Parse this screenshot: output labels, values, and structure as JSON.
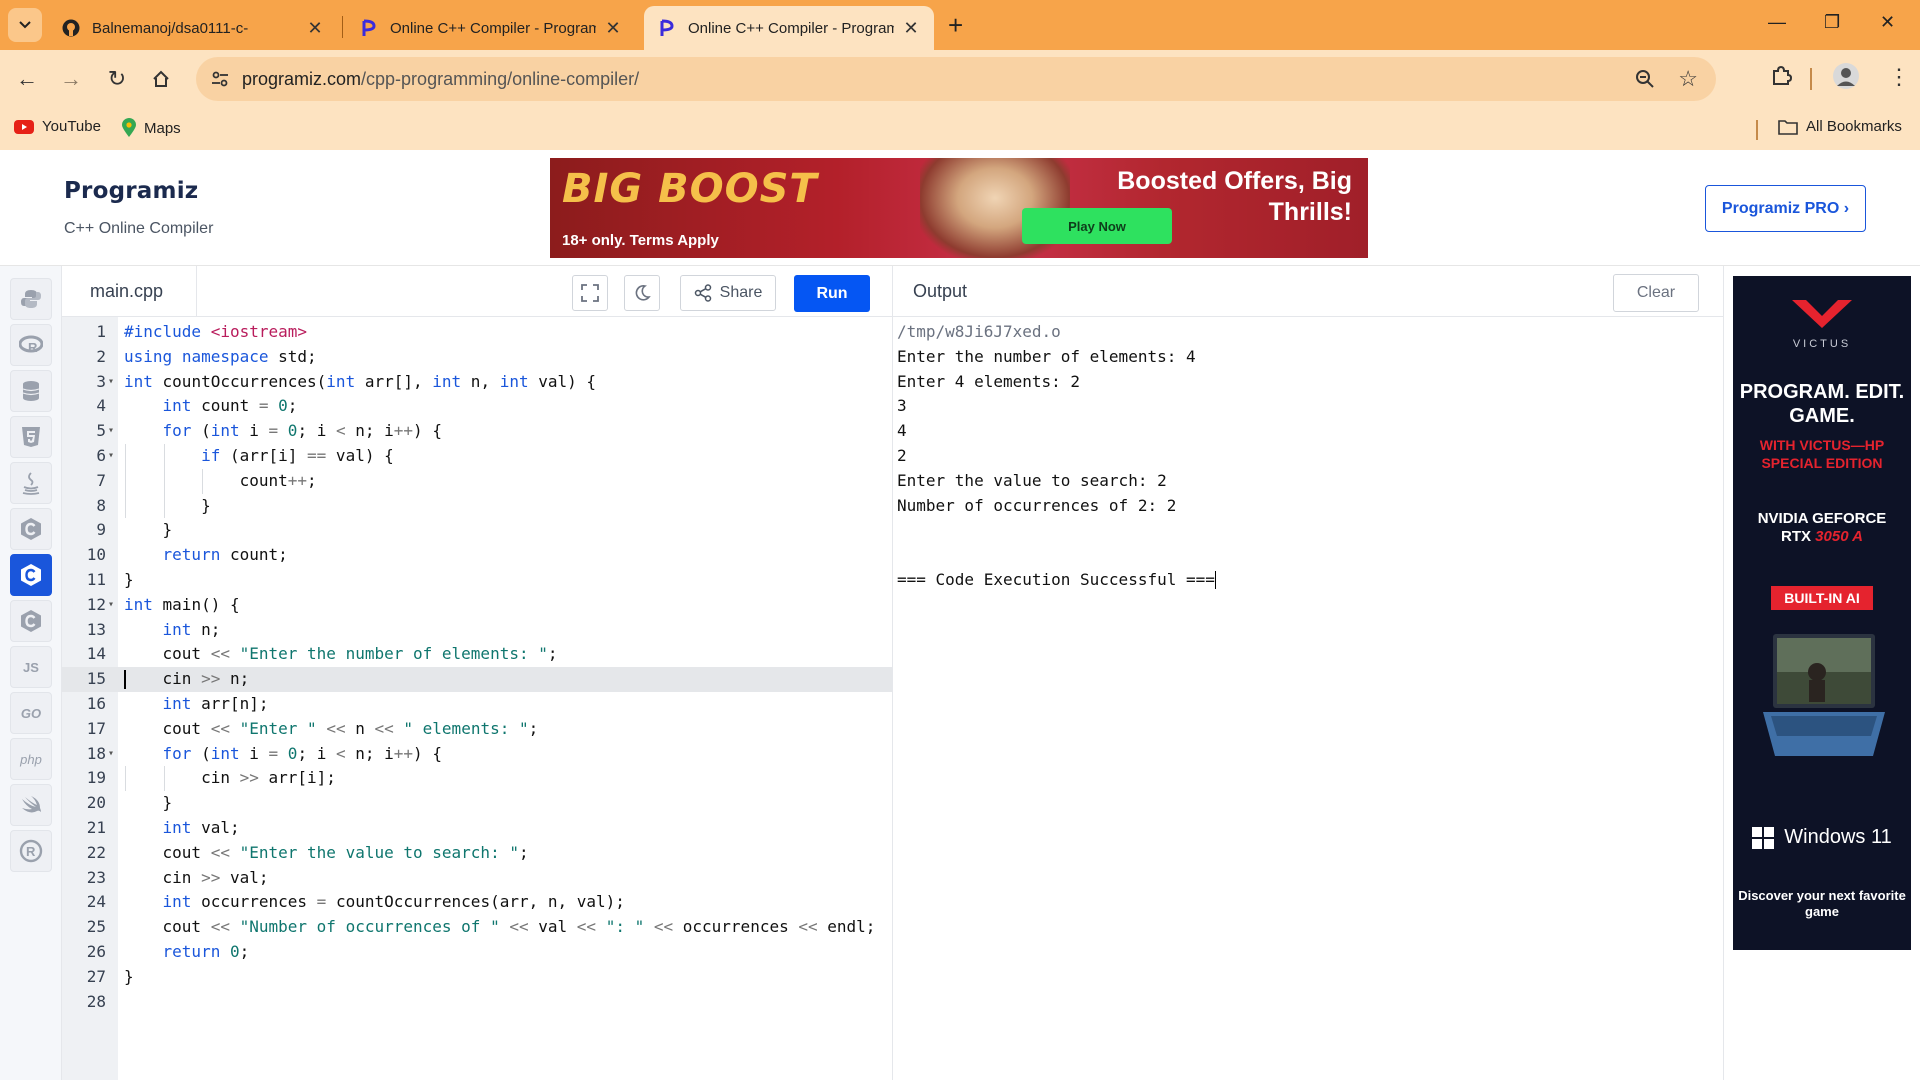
{
  "browser": {
    "tabs": [
      {
        "title": "Balnemanoj/dsa0111-c-",
        "favicon": "github-icon"
      },
      {
        "title": "Online C++ Compiler - Program",
        "favicon": "programiz-icon"
      },
      {
        "title": "Online C++ Compiler - Program",
        "favicon": "programiz-icon"
      }
    ],
    "url_host": "programiz.com",
    "url_path": "/cpp-programming/online-compiler/",
    "bookmarks": [
      {
        "label": "YouTube",
        "icon": "youtube-icon"
      },
      {
        "label": "Maps",
        "icon": "maps-icon"
      }
    ],
    "all_bookmarks_label": "All Bookmarks"
  },
  "header": {
    "logo_text": "Programiz",
    "subtitle": "C++ Online Compiler",
    "pro_button": "Programiz PRO ›"
  },
  "ad_banner": {
    "brand": "BIG BOOST",
    "terms": "18+ only. Terms Apply",
    "headline_line1": "Boosted Offers, Big",
    "headline_line2": "Thrills!",
    "cta": "Play Now"
  },
  "languages": [
    {
      "name": "python-icon"
    },
    {
      "name": "r-icon"
    },
    {
      "name": "sql-icon"
    },
    {
      "name": "html5-icon"
    },
    {
      "name": "java-icon"
    },
    {
      "name": "c-icon"
    },
    {
      "name": "cpp-icon",
      "active": true
    },
    {
      "name": "csharp-icon"
    },
    {
      "name": "js-icon",
      "label": "JS"
    },
    {
      "name": "go-icon",
      "label": "GO"
    },
    {
      "name": "php-icon",
      "label": "php"
    },
    {
      "name": "swift-icon"
    },
    {
      "name": "rust-icon"
    }
  ],
  "editor": {
    "filename": "main.cpp",
    "share_label": "Share",
    "run_label": "Run",
    "current_line": 15,
    "line_numbers": [
      "1",
      "2",
      "3",
      "4",
      "5",
      "6",
      "7",
      "8",
      "9",
      "10",
      "11",
      "12",
      "13",
      "14",
      "15",
      "16",
      "17",
      "18",
      "19",
      "20",
      "21",
      "22",
      "23",
      "24",
      "25",
      "26",
      "27",
      "28"
    ],
    "code_lines": [
      "#include <iostream>",
      "using namespace std;",
      "int countOccurrences(int arr[], int n, int val) {",
      "    int count = 0;",
      "    for (int i = 0; i < n; i++) {",
      "        if (arr[i] == val) {",
      "            count++;",
      "        }",
      "    }",
      "    return count;",
      "}",
      "int main() {",
      "    int n;",
      "    cout << \"Enter the number of elements: \";",
      "    cin >> n;",
      "    int arr[n];",
      "    cout << \"Enter \" << n << \" elements: \";",
      "    for (int i = 0; i < n; i++) {",
      "        cin >> arr[i];",
      "    }",
      "    int val;",
      "    cout << \"Enter the value to search: \";",
      "    cin >> val;",
      "    int occurrences = countOccurrences(arr, n, val);",
      "    cout << \"Number of occurrences of \" << val << \": \" << occurrences << endl;",
      "    return 0;",
      "}",
      ""
    ]
  },
  "output": {
    "title": "Output",
    "clear_label": "Clear",
    "lines": [
      "/tmp/w8Ji6J7xed.o",
      "Enter the number of elements: 4",
      "Enter 4 elements: 2",
      "3",
      "4",
      "2",
      "Enter the value to search: 2",
      "Number of occurrences of 2: 2",
      "",
      "",
      "=== Code Execution Successful ==="
    ]
  },
  "side_ad": {
    "brand": "VICTUS",
    "headline": "PROGRAM. EDIT. GAME.",
    "subhead": "WITH VICTUS—HP SPECIAL EDITION",
    "gpu_line1": "NVIDIA GEFORCE",
    "gpu_line2": "RTX",
    "gpu_model": "3050 A",
    "ai_badge": "BUILT-IN AI",
    "os": "Windows 11",
    "cta": "Discover your next favorite game"
  },
  "colors": {
    "tabbar": "#f7a44a",
    "toolbar": "#fde3c1",
    "run_button": "#0556f3",
    "keyword": "#1a56db",
    "string": "#0f766e"
  }
}
